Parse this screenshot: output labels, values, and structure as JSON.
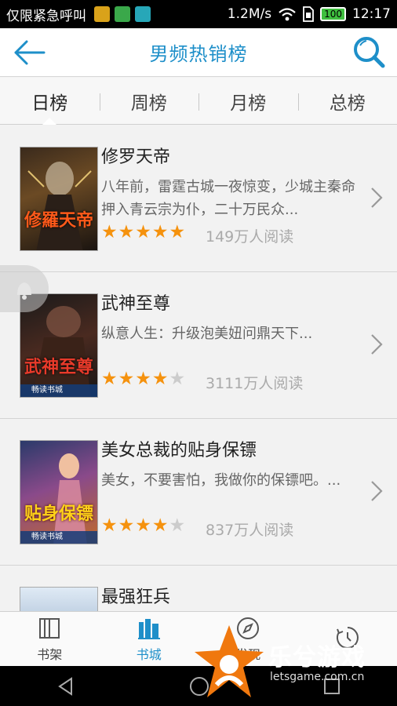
{
  "status_bar": {
    "carrier": "仅限紧急呼叫",
    "speed": "1.2M/s",
    "battery": "100",
    "time": "12:17"
  },
  "header": {
    "title": "男频热销榜",
    "back_icon": "back-arrow-icon",
    "search_icon": "search-icon"
  },
  "tabs": [
    {
      "label": "日榜",
      "active": true
    },
    {
      "label": "周榜",
      "active": false
    },
    {
      "label": "月榜",
      "active": false
    },
    {
      "label": "总榜",
      "active": false
    }
  ],
  "books": [
    {
      "title": "修罗天帝",
      "desc": "八年前，雷霆古城一夜惊变，少城主秦命押入青云宗为仆，二十万民众...",
      "rating": 5,
      "reads": "149万人阅读",
      "cover_text": "修羅天帝"
    },
    {
      "title": "武神至尊",
      "desc": "纵意人生：升级泡美妞问鼎天下...",
      "rating": 4,
      "reads": "3111万人阅读",
      "cover_text": "武神至尊",
      "cover_badge": "畅读书城"
    },
    {
      "title": "美女总裁的贴身保镖",
      "desc": "美女，不要害怕，我做你的保镖吧。...",
      "rating": 4,
      "reads": "837万人阅读",
      "cover_text": "贴身保镖",
      "cover_badge": "畅读书城"
    },
    {
      "title": "最强狂兵",
      "desc": "",
      "rating": 0,
      "reads": ""
    }
  ],
  "bottom_nav": [
    {
      "label": "书架",
      "icon": "bookshelf-icon",
      "active": false
    },
    {
      "label": "书城",
      "icon": "bookstore-icon",
      "active": true
    },
    {
      "label": "发现",
      "icon": "compass-icon",
      "active": false
    },
    {
      "label": "",
      "icon": "history-icon",
      "active": false
    }
  ],
  "watermark": {
    "brand": "乐兮游戏",
    "url": "letsgame.com.cn"
  },
  "colors": {
    "accent": "#1e8fc9",
    "star": "#f5920e"
  }
}
